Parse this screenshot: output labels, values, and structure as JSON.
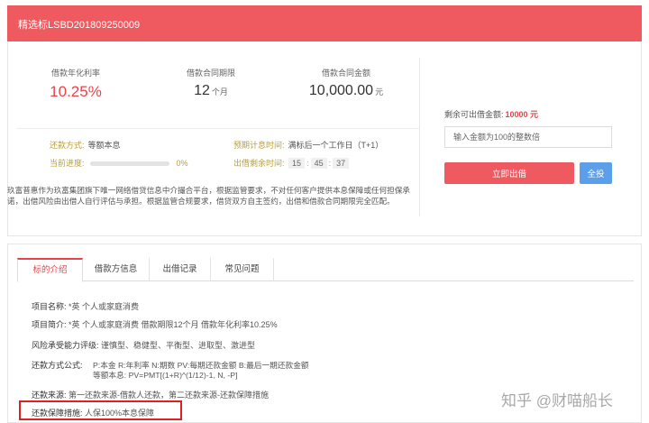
{
  "header": {
    "title": "精选标LSBD201809250009"
  },
  "stats": {
    "rate_label": "借款年化利率",
    "rate_value": "10.25%",
    "term_label": "借款合同期限",
    "term_value": "12",
    "term_unit": "个月",
    "amount_label": "借款合同金额",
    "amount_value": "10,000.00",
    "amount_unit": "元"
  },
  "info": {
    "repay_label": "还款方式:",
    "repay_value": "等额本息",
    "progress_label": "当前进度:",
    "progress_percent": 0,
    "progress_text": "0%",
    "interest_label": "预期计息时间:",
    "interest_value": "满标后一个工作日（T+1）",
    "countdown_label": "出借剩余时间:",
    "countdown": [
      "15",
      "45",
      "37"
    ]
  },
  "description": "玖富普惠作为玖富集团旗下唯一网络借贷信息中介撮合平台，根据监管要求，不对任何客户提供本息保障或任何担保承诺，出借风险由出借人自行评估与承担。根据监管合规要求，借贷双方自主签约，出借和借款合同期限完全匹配。",
  "invest": {
    "remain_label": "剩余可出借金额:",
    "remain_amount": "10000 元",
    "input_placeholder": "输入金额为100的整数倍",
    "lend_button": "立即出借",
    "all_button": "全投"
  },
  "tabs": [
    {
      "label": "标的介绍"
    },
    {
      "label": "借款方信息"
    },
    {
      "label": "出借记录"
    },
    {
      "label": "常见问题"
    }
  ],
  "details": {
    "name_label": "项目名称:",
    "name_value": "*英 个人或家庭消费",
    "intro_label": "项目简介:",
    "intro_value": "*英 个人或家庭消费 借款期限12个月 借款年化利率10.25%",
    "risk_label": "风险承受能力评级:",
    "risk_value": "谨慎型、稳健型、平衡型、进取型、激进型",
    "formula_label": "还款方式公式:",
    "formula_line1": "P:本金 R:年利率 N:期数 PV:每期还款金额 B:最后一期还款金额",
    "formula_line2": "等额本息: PV=PMT[(1+R)^(1/12)-1, N, -P]",
    "source_label": "还款来源:",
    "source_value": "第一还款来源-借款人还款，第二还款来源-还款保障措施",
    "guarantee_label": "还款保障措施:",
    "guarantee_value": "人保100%本息保障"
  },
  "watermark": "知乎 @财喵船长",
  "colors": {
    "brand_red": "#ee5a5f",
    "accent_blue": "#5b9ee9",
    "label_gold": "#b9a03c"
  }
}
